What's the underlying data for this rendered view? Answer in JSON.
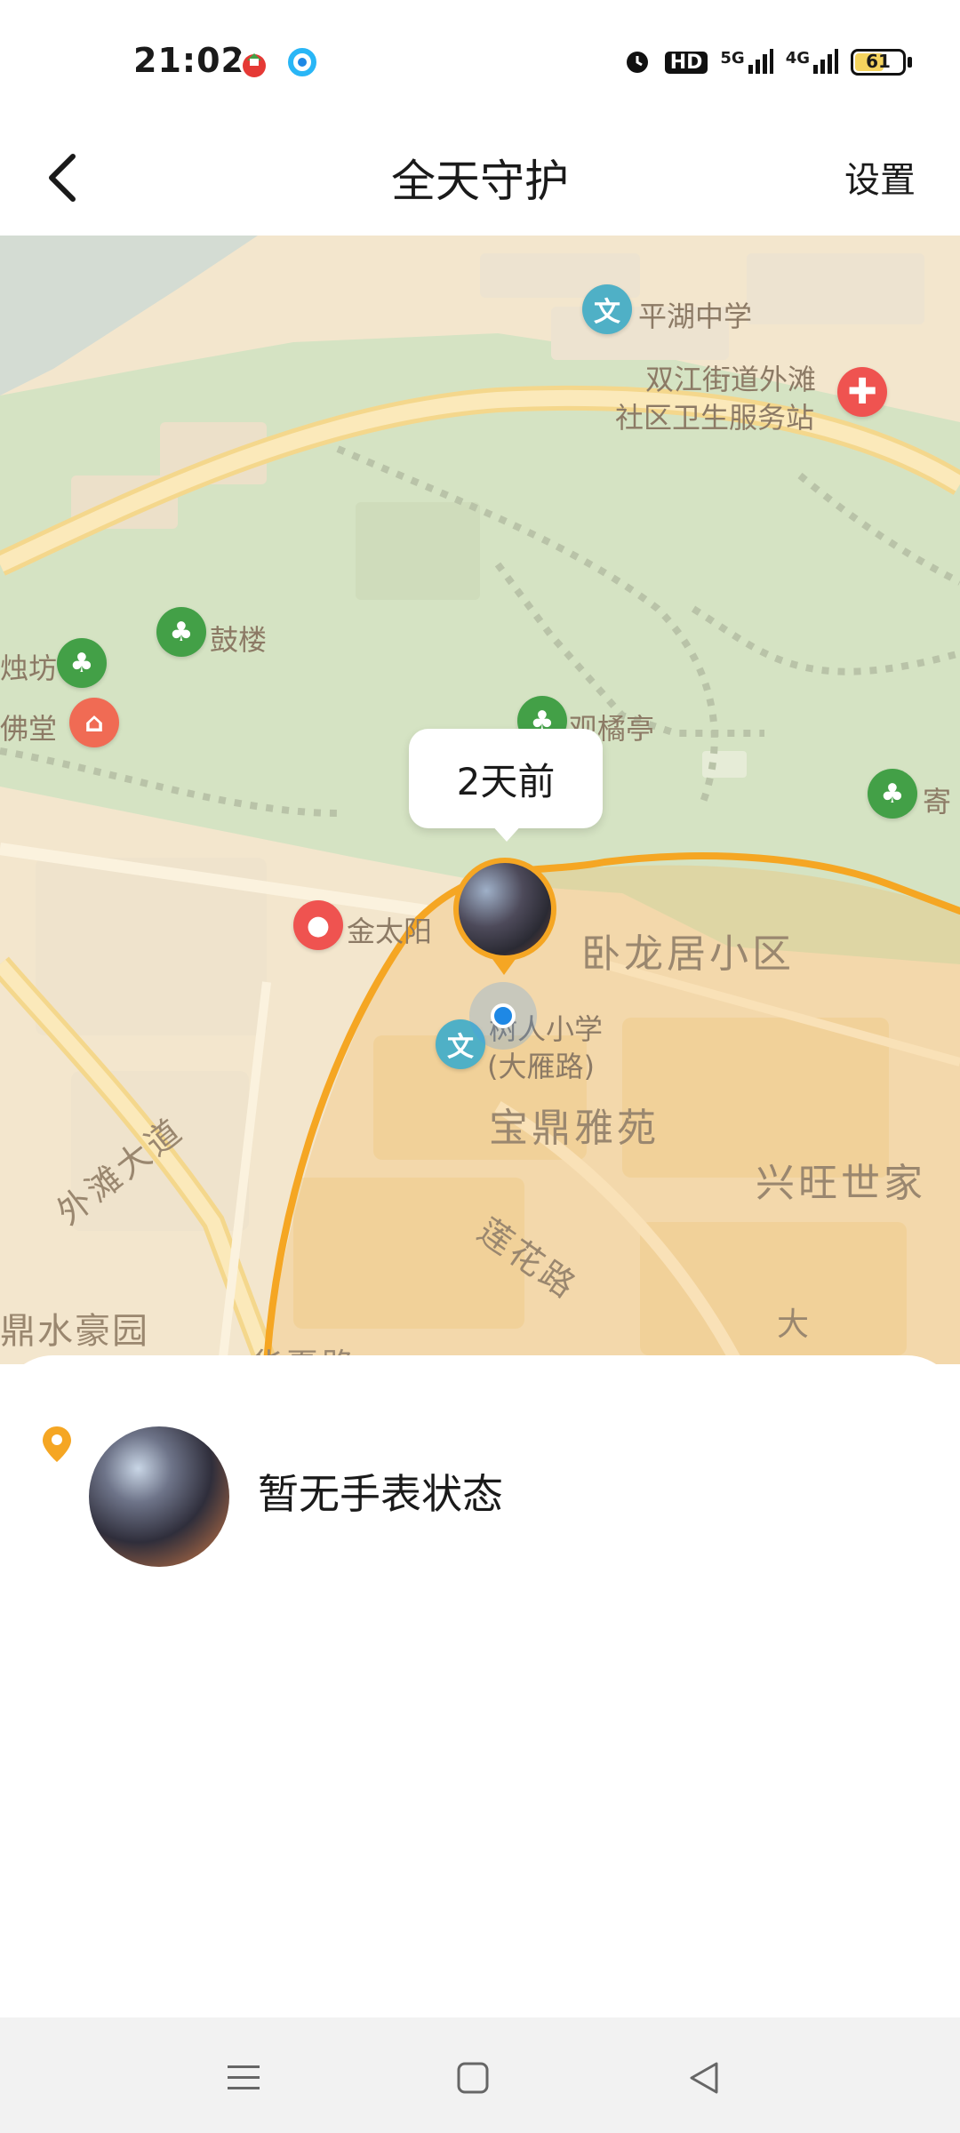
{
  "status_bar": {
    "time": "21:02",
    "battery_level": 61,
    "battery_text": "61",
    "network_labels": [
      "HD",
      "5G",
      "4G"
    ],
    "icons": [
      "app-home-icon",
      "app-browser-icon",
      "alarm-icon",
      "hd-icon",
      "signal-5g-icon",
      "signal-4g-icon",
      "battery-icon"
    ]
  },
  "nav": {
    "title": "全天守护",
    "settings_label": "设置",
    "back_icon": "back-arrow-icon"
  },
  "map": {
    "labels": {
      "pinghu_school": "平湖中学",
      "health_station_1": "双江街道外滩",
      "health_station_2": "社区卫生服务站",
      "gulou": "鼓楼",
      "zhufang": "烛坊",
      "fotang": "佛堂",
      "guanju": "观橘亭",
      "jitong": "寄",
      "jintaiyang": "金太阳",
      "wolongju": "卧龙居小区",
      "shuren_1": "树人小学",
      "shuren_2": "(大雁路)",
      "baoding": "宝鼎雅苑",
      "xingwang": "兴旺世家",
      "waitan": "外滩大道",
      "lianhua": "莲花路",
      "haoyuan": "鼎水豪园",
      "da": "大",
      "huaxia": "华夏路"
    },
    "bubble_text": "2天前",
    "route_color": "#f5a623",
    "location_color": "#1e88e5"
  },
  "sheet": {
    "status_text": "暂无手表状态",
    "pin_color": "#f5a623"
  },
  "system_nav": {
    "icons": [
      "menu-icon",
      "home-square-icon",
      "back-triangle-icon"
    ]
  }
}
